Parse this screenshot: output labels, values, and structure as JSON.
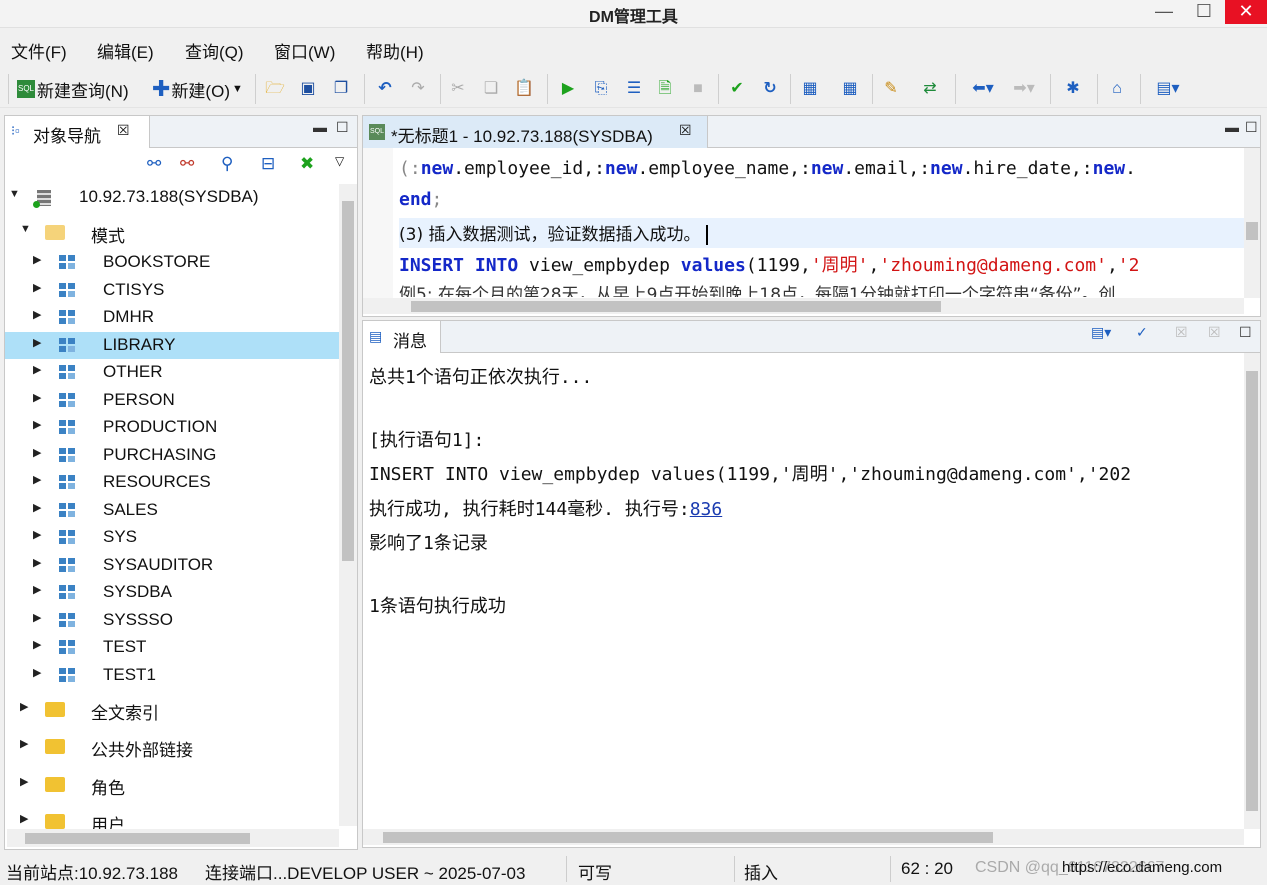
{
  "window": {
    "title": "DM管理工具",
    "min": "—",
    "max": "☐",
    "close": "✕"
  },
  "menu": [
    "文件(F)",
    "编辑(E)",
    "查询(Q)",
    "窗口(W)",
    "帮助(H)"
  ],
  "toolbar": {
    "new_query": "新建查询(N)",
    "new": "新建(O)"
  },
  "nav": {
    "tab_label": "对象导航",
    "connection": "10.92.73.188(SYSDBA)",
    "schema_folder": "模式",
    "schemas": [
      "BOOKSTORE",
      "CTISYS",
      "DMHR",
      "LIBRARY",
      "OTHER",
      "PERSON",
      "PRODUCTION",
      "PURCHASING",
      "RESOURCES",
      "SALES",
      "SYS",
      "SYSAUDITOR",
      "SYSDBA",
      "SYSSSO",
      "TEST",
      "TEST1"
    ],
    "selected": "LIBRARY",
    "folders": [
      "全文索引",
      "公共外部链接",
      "角色",
      "用户"
    ]
  },
  "editor": {
    "tab_label": "*无标题1 - 10.92.73.188(SYSDBA)",
    "line1": {
      "a": "(:",
      "new1": "new",
      "b": ".employee_id,:",
      "new2": "new",
      "c": ".employee_name,:",
      "new3": "new",
      "d": ".email,:",
      "new4": "new",
      "e": ".hire_date,:",
      "new5": "new",
      "f": "."
    },
    "line2": "end",
    "line2_tail": ";",
    "line3": "(3) 插入数据测试，验证数据插入成功。",
    "line4": {
      "kw1": "INSERT INTO",
      "plain1": " view_empbydep ",
      "kw2": "values",
      "plain2": "(1199,",
      "s1": "'周明'",
      "c1": ",",
      "s2": "'zhouming@dameng.com'",
      "c2": ",",
      "s3": "'2"
    },
    "line5": "例5: 在每个月的第28天，从早上9点开始到晚上18点，每隔1分钟就打印一个字符串“备份”。创"
  },
  "messages": {
    "tab_label": "消息",
    "lines": [
      "总共1个语句正依次执行...",
      "[执行语句1]:",
      "INSERT INTO view_empbydep values(1199,'周明','zhouming@dameng.com','202"
    ],
    "exec_prefix": "执行成功, 执行耗时144毫秒. 执行号:",
    "exec_id": "836",
    "affected": "影响了1条记录",
    "summary": "1条语句执行成功"
  },
  "status": {
    "site": "当前站点:10.92.73.188",
    "port": "连接端口...DEVELOP USER ~ 2025-07-03",
    "mode": "可写",
    "insert": "插入",
    "pos": "62 : 20",
    "url": "https://eco.dameng.com",
    "watermark": "CSDN @qq_61167322667"
  }
}
